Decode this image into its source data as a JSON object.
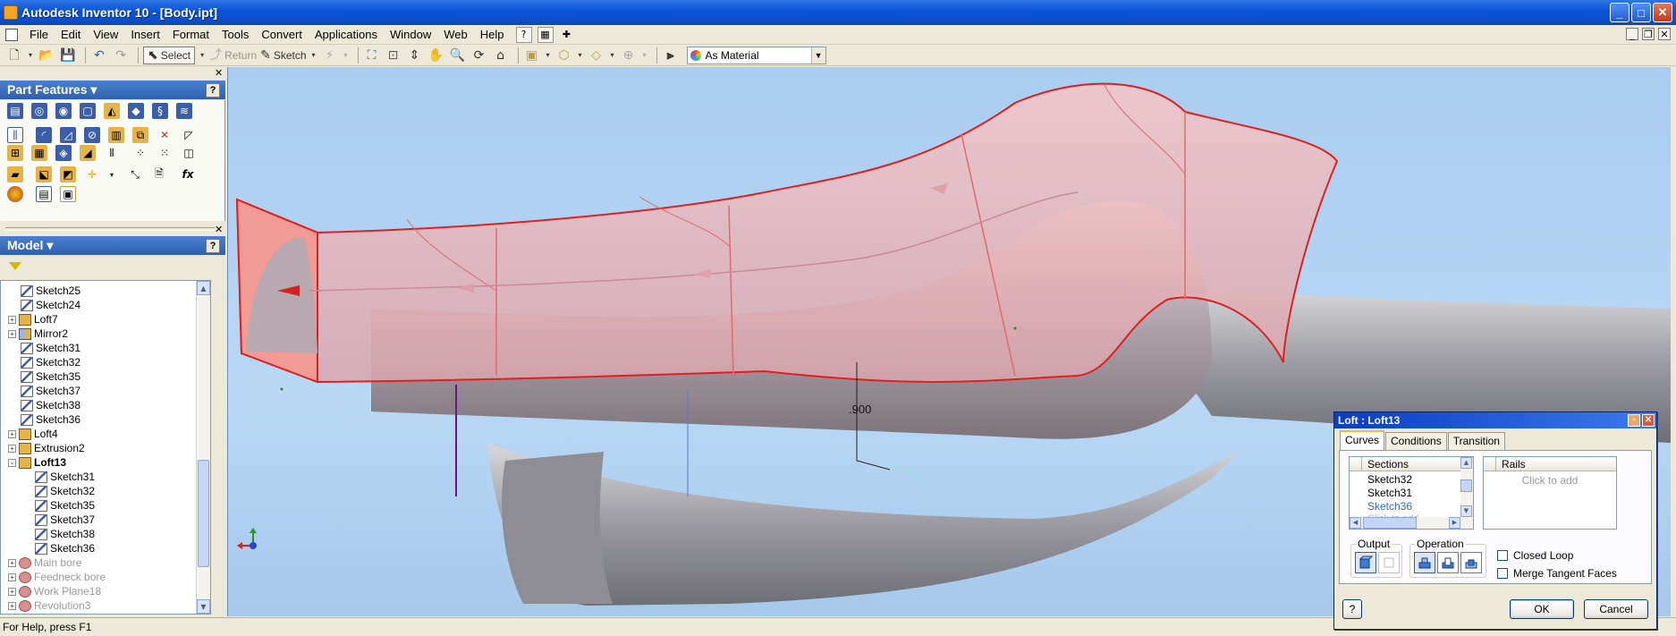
{
  "window": {
    "title": "Autodesk Inventor 10 - [Body.ipt]",
    "controls": {
      "minimize": "_",
      "maximize": "□",
      "close": "✕"
    }
  },
  "menubar": {
    "items": [
      "File",
      "Edit",
      "View",
      "Insert",
      "Format",
      "Tools",
      "Convert",
      "Applications",
      "Window",
      "Help"
    ],
    "mdi": {
      "minimize": "_",
      "restore": "❐",
      "close": "✕"
    }
  },
  "toolbar": {
    "select_label": "Select",
    "return_label": "Return",
    "sketch_label": "Sketch",
    "material_value": "As Material"
  },
  "part_features": {
    "title": "Part Features",
    "help": "?",
    "fx": "fx"
  },
  "model": {
    "title": "Model",
    "help": "?",
    "tree": [
      {
        "label": "Sketch25",
        "icon": "sketch",
        "indent": 1,
        "expand": ""
      },
      {
        "label": "Sketch24",
        "icon": "sketch",
        "indent": 1,
        "expand": ""
      },
      {
        "label": "Loft7",
        "icon": "feature",
        "indent": 0,
        "expand": "+"
      },
      {
        "label": "Mirror2",
        "icon": "mirror",
        "indent": 0,
        "expand": "+"
      },
      {
        "label": "Sketch31",
        "icon": "sketch",
        "indent": 1,
        "expand": ""
      },
      {
        "label": "Sketch32",
        "icon": "sketch",
        "indent": 1,
        "expand": ""
      },
      {
        "label": "Sketch35",
        "icon": "sketch",
        "indent": 1,
        "expand": ""
      },
      {
        "label": "Sketch37",
        "icon": "sketch",
        "indent": 1,
        "expand": ""
      },
      {
        "label": "Sketch38",
        "icon": "sketch",
        "indent": 1,
        "expand": ""
      },
      {
        "label": "Sketch36",
        "icon": "sketch",
        "indent": 1,
        "expand": ""
      },
      {
        "label": "Loft4",
        "icon": "feature",
        "indent": 0,
        "expand": "+"
      },
      {
        "label": "Extrusion2",
        "icon": "feature",
        "indent": 0,
        "expand": "+"
      },
      {
        "label": "Loft13",
        "icon": "feature",
        "indent": 0,
        "expand": "-",
        "bold": true
      },
      {
        "label": "Sketch31",
        "icon": "sketch",
        "indent": 2,
        "expand": ""
      },
      {
        "label": "Sketch32",
        "icon": "sketch",
        "indent": 2,
        "expand": ""
      },
      {
        "label": "Sketch35",
        "icon": "sketch",
        "indent": 2,
        "expand": ""
      },
      {
        "label": "Sketch37",
        "icon": "sketch",
        "indent": 2,
        "expand": ""
      },
      {
        "label": "Sketch38",
        "icon": "sketch",
        "indent": 2,
        "expand": ""
      },
      {
        "label": "Sketch36",
        "icon": "sketch",
        "indent": 2,
        "expand": ""
      },
      {
        "label": "Main bore",
        "icon": "suppressed",
        "indent": 0,
        "expand": "+",
        "grey": true
      },
      {
        "label": "Feedneck bore",
        "icon": "suppressed",
        "indent": 0,
        "expand": "+",
        "grey": true
      },
      {
        "label": "Work Plane18",
        "icon": "suppressed",
        "indent": 0,
        "expand": "+",
        "grey": true
      },
      {
        "label": "Revolution3",
        "icon": "suppressed",
        "indent": 0,
        "expand": "+",
        "grey": true
      }
    ]
  },
  "viewport": {
    "dimension_label": ".900"
  },
  "status": {
    "text": "For Help, press F1"
  },
  "loft_dialog": {
    "title": "Loft : Loft13",
    "tabs": [
      "Curves",
      "Conditions",
      "Transition"
    ],
    "sections_header": "Sections",
    "sections": [
      "Sketch32",
      "Sketch31",
      "Sketch36"
    ],
    "sections_partial": "Click to add",
    "rails_header": "Rails",
    "rails_placeholder": "Click to add",
    "output_label": "Output",
    "operation_label": "Operation",
    "closed_loop": "Closed Loop",
    "merge_tangent": "Merge Tangent Faces",
    "ok": "OK",
    "cancel": "Cancel",
    "help": "?"
  }
}
